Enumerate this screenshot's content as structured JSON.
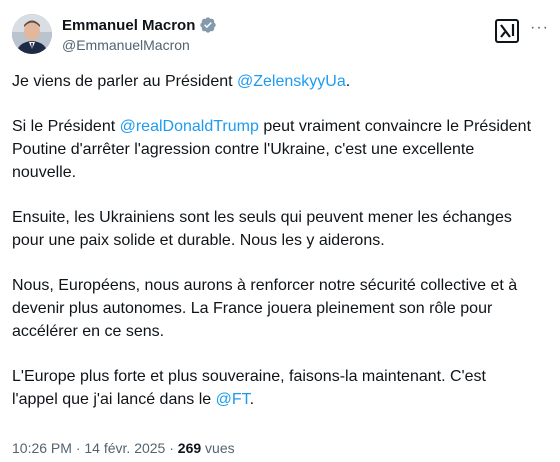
{
  "author": {
    "name": "Emmanuel Macron",
    "handle": "@EmmanuelMacron",
    "verified_icon": "verified-badge-icon"
  },
  "header_actions": {
    "grok_icon": "grok-icon",
    "more_label": "···"
  },
  "tweet": {
    "p1_text": "Je viens de parler au Président ",
    "p1_mention": "@ZelenskyyUa",
    "p1_end": ".",
    "p2_start": "Si le Président ",
    "p2_mention": "@realDonaldTrump",
    "p2_line1_end": " peut vraiment convaincre le Président",
    "p2_line2": "Poutine d'arrêter l'agression contre l'Ukraine, c'est une excellente",
    "p2_line3": "nouvelle.",
    "p3_line1": "Ensuite, les Ukrainiens sont les seuls qui peuvent mener les échanges",
    "p3_line2": "pour une paix solide et durable. Nous les y aiderons.",
    "p4_line1": "Nous, Européens, nous aurons à renforcer notre sécurité collective et à",
    "p4_line2": "devenir plus autonomes. La France jouera pleinement son rôle pour",
    "p4_line3": "accélérer en ce sens.",
    "p5_line1": "L'Europe plus forte et plus souveraine, faisons-la maintenant. C'est",
    "p5_line2_start": "l'appel que j'ai lancé dans le ",
    "p5_mention": "@FT",
    "p5_end": "."
  },
  "meta": {
    "time": "10:26 PM",
    "separator1": " · ",
    "date": "14 févr. 2025",
    "separator2": " · ",
    "views_count": "269",
    "views_label": " vues"
  },
  "colors": {
    "link": "#1d9bf0",
    "text": "#0f1419",
    "muted": "#536471"
  }
}
